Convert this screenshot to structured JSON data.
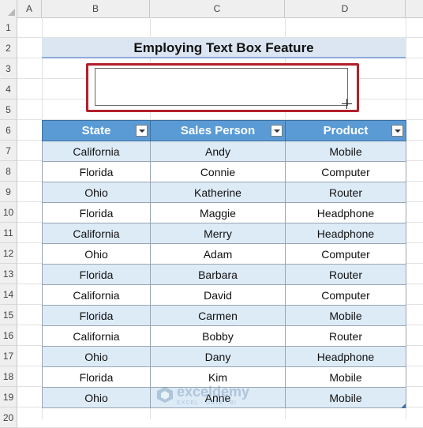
{
  "columns": [
    "A",
    "B",
    "C",
    "D"
  ],
  "rows": [
    "1",
    "2",
    "3",
    "4",
    "5",
    "6",
    "7",
    "8",
    "9",
    "10",
    "11",
    "12",
    "13",
    "14",
    "15",
    "16",
    "17",
    "18",
    "19",
    "20"
  ],
  "title": "Employing Text Box Feature",
  "table": {
    "headers": [
      "State",
      "Sales Person",
      "Product"
    ],
    "rows": [
      [
        "California",
        "Andy",
        "Mobile"
      ],
      [
        "Florida",
        "Connie",
        "Computer"
      ],
      [
        "Ohio",
        "Katherine",
        "Router"
      ],
      [
        "Florida",
        "Maggie",
        "Headphone"
      ],
      [
        "California",
        "Merry",
        "Headphone"
      ],
      [
        "Ohio",
        "Adam",
        "Computer"
      ],
      [
        "Florida",
        "Barbara",
        "Router"
      ],
      [
        "California",
        "David",
        "Computer"
      ],
      [
        "Florida",
        "Carmen",
        "Mobile"
      ],
      [
        "California",
        "Bobby",
        "Router"
      ],
      [
        "Ohio",
        "Dany",
        "Headphone"
      ],
      [
        "Florida",
        "Kim",
        "Mobile"
      ],
      [
        "Ohio",
        "Anne",
        "Mobile"
      ]
    ]
  },
  "textbox": {
    "value": ""
  },
  "watermark": {
    "name": "exceldemy",
    "tagline": "EXCEL · DATA · BI"
  },
  "colors": {
    "header_fill": "#5b9bd5",
    "band_fill": "#ddebf7",
    "title_fill": "#dce6f2",
    "highlight": "#b2202a"
  }
}
